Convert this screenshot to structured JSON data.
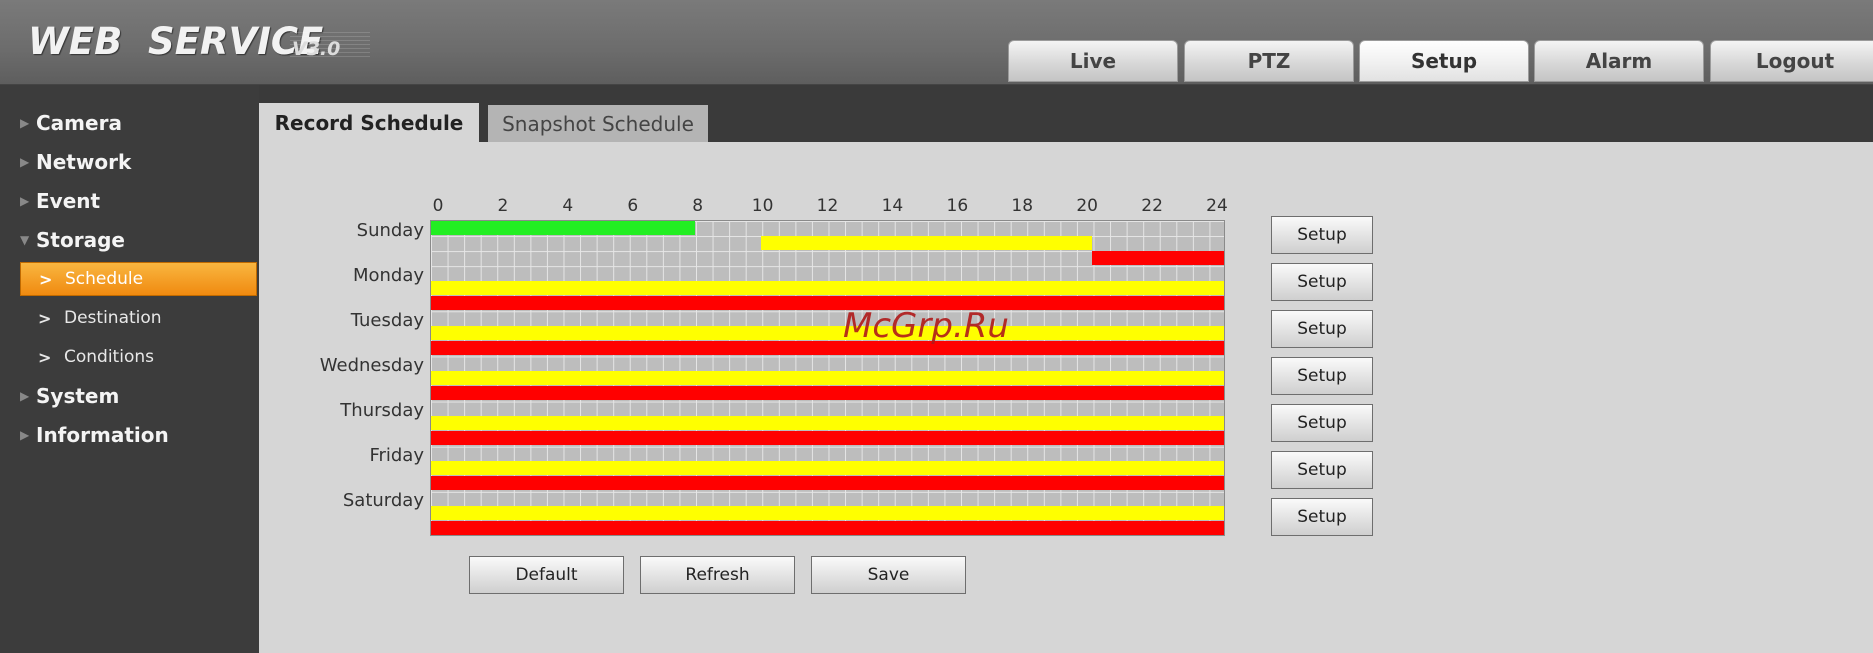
{
  "logo": {
    "text": "WEB  SERVICE",
    "version": "V3.0"
  },
  "top_nav": [
    {
      "label": "Live"
    },
    {
      "label": "PTZ"
    },
    {
      "label": "Setup",
      "active": true
    },
    {
      "label": "Alarm"
    },
    {
      "label": "Logout"
    }
  ],
  "sidebar": {
    "items": [
      {
        "label": "Camera",
        "expanded": false
      },
      {
        "label": "Network",
        "expanded": false
      },
      {
        "label": "Event",
        "expanded": false
      },
      {
        "label": "Storage",
        "expanded": true
      },
      {
        "label": "System",
        "expanded": false
      },
      {
        "label": "Information",
        "expanded": false
      }
    ],
    "storage_sub": [
      {
        "label": "Schedule",
        "active": true
      },
      {
        "label": "Destination"
      },
      {
        "label": "Conditions"
      }
    ]
  },
  "tabs": [
    {
      "label": "Record Schedule",
      "active": true
    },
    {
      "label": "Snapshot Schedule"
    }
  ],
  "schedule": {
    "hour_labels": [
      "0",
      "2",
      "4",
      "6",
      "8",
      "10",
      "12",
      "14",
      "16",
      "18",
      "20",
      "22",
      "24"
    ],
    "days": [
      "Sunday",
      "Monday",
      "Tuesday",
      "Wednesday",
      "Thursday",
      "Friday",
      "Saturday"
    ],
    "colors": {
      "green": "#22ee22",
      "yellow": "#ffff00",
      "red": "#ff0000"
    },
    "segments": [
      {
        "day": 0,
        "row": 0,
        "start": 0,
        "end": 8,
        "color": "green"
      },
      {
        "day": 0,
        "row": 1,
        "start": 10,
        "end": 20,
        "color": "yellow"
      },
      {
        "day": 0,
        "row": 2,
        "start": 20,
        "end": 24,
        "color": "red"
      },
      {
        "day": 1,
        "row": 1,
        "start": 0,
        "end": 24,
        "color": "yellow"
      },
      {
        "day": 1,
        "row": 2,
        "start": 0,
        "end": 24,
        "color": "red"
      },
      {
        "day": 2,
        "row": 1,
        "start": 0,
        "end": 24,
        "color": "yellow"
      },
      {
        "day": 2,
        "row": 2,
        "start": 0,
        "end": 24,
        "color": "red"
      },
      {
        "day": 3,
        "row": 1,
        "start": 0,
        "end": 24,
        "color": "yellow"
      },
      {
        "day": 3,
        "row": 2,
        "start": 0,
        "end": 24,
        "color": "red"
      },
      {
        "day": 4,
        "row": 1,
        "start": 0,
        "end": 24,
        "color": "yellow"
      },
      {
        "day": 4,
        "row": 2,
        "start": 0,
        "end": 24,
        "color": "red"
      },
      {
        "day": 5,
        "row": 1,
        "start": 0,
        "end": 24,
        "color": "yellow"
      },
      {
        "day": 5,
        "row": 2,
        "start": 0,
        "end": 24,
        "color": "red"
      },
      {
        "day": 6,
        "row": 1,
        "start": 0,
        "end": 24,
        "color": "yellow"
      },
      {
        "day": 6,
        "row": 2,
        "start": 0,
        "end": 24,
        "color": "red"
      }
    ]
  },
  "setup_button_label": "Setup",
  "buttons": {
    "default": "Default",
    "refresh": "Refresh",
    "save": "Save"
  },
  "watermark": "McGrp.Ru"
}
